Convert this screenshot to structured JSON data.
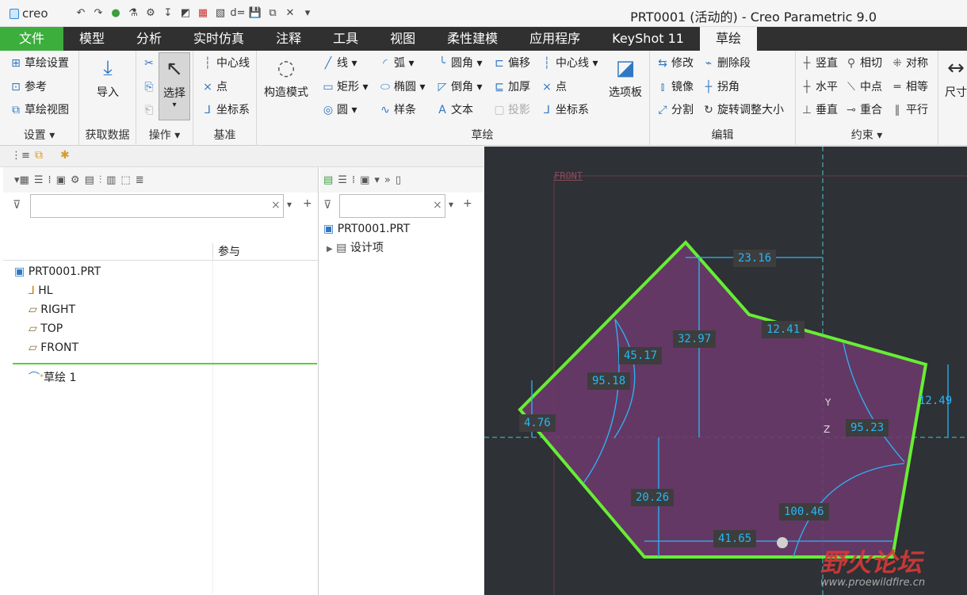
{
  "app": {
    "logo": "creo",
    "window_title": "PRT0001 (活动的) - Creo Parametric 9.0"
  },
  "quick_access": [
    "↶",
    "↷",
    "●",
    "⚗",
    "⚙",
    "↧",
    "◩",
    "▦",
    "▧",
    "d=",
    "💾",
    "⧉",
    "✕",
    "▾"
  ],
  "tabs": [
    "文件",
    "模型",
    "分析",
    "实时仿真",
    "注释",
    "工具",
    "视图",
    "柔性建模",
    "应用程序",
    "KeyShot 11",
    "草绘"
  ],
  "ribbon": {
    "setup": {
      "items": [
        "草绘设置",
        "参考",
        "草绘视图"
      ],
      "label": "设置"
    },
    "get_data": {
      "import": "导入",
      "label": "获取数据"
    },
    "operations": {
      "select": "选择",
      "label": "操作"
    },
    "datum": {
      "items": [
        "中心线",
        "点",
        "坐标系"
      ],
      "label": "基准"
    },
    "construction": {
      "label": "构造模式"
    },
    "sketching": {
      "col1": [
        "线",
        "矩形",
        "圆"
      ],
      "col2": [
        "弧",
        "椭圆",
        "样条"
      ],
      "col3": [
        "圆角",
        "倒角",
        "文本"
      ],
      "col4": [
        "偏移",
        "加厚",
        "投影"
      ],
      "col5": [
        "中心线",
        "点",
        "坐标系"
      ],
      "palette": "选项板",
      "label": "草绘"
    },
    "editing": {
      "items": [
        "修改",
        "删除段",
        "镜像",
        "拐角",
        "分割",
        "旋转调整大小"
      ],
      "label": "编辑"
    },
    "constraints": {
      "items": [
        "竖直",
        "相切",
        "对称",
        "水平",
        "中点",
        "相等",
        "垂直",
        "重合",
        "平行"
      ],
      "label": "约束"
    },
    "dimension": {
      "label": "尺寸"
    }
  },
  "model_tree": {
    "column_header": "参与",
    "filter_placeholder": "",
    "nodes": [
      "PRT0001.PRT",
      "HL",
      "RIGHT",
      "TOP",
      "FRONT",
      "草绘 1"
    ]
  },
  "layer_tree": {
    "nodes": [
      "PRT0001.PRT",
      "设计项"
    ]
  },
  "sketch": {
    "plane_label": "FRONT",
    "dims": [
      "23.16",
      "32.97",
      "12.41",
      "45.17",
      "95.18",
      "4.76",
      "95.23",
      "12.49",
      "20.26",
      "100.46",
      "41.65"
    ],
    "axis_labels": [
      "Y",
      "Z"
    ]
  },
  "watermark": {
    "text": "野火论坛",
    "url": "www.proewildfire.cn"
  }
}
